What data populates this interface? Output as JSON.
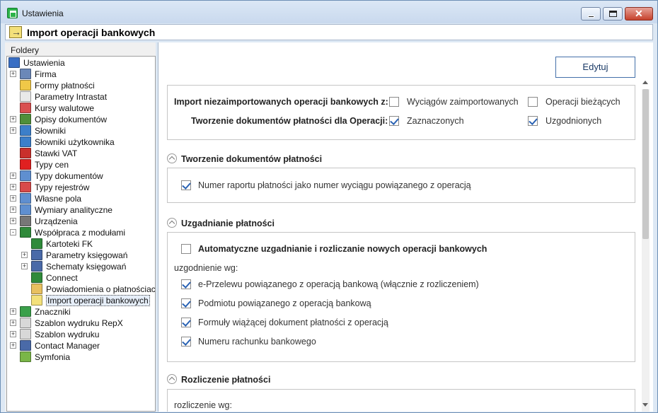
{
  "window": {
    "title": "Ustawienia",
    "accent_color": "#2cb34a",
    "controls": {
      "minimize_icon": "minimize-icon",
      "maximize_icon": "maximize-icon",
      "close_icon": "close-icon",
      "close_glyph": "✕"
    }
  },
  "header": {
    "title": "Import operacji bankowych",
    "icon": "import-arrow-icon"
  },
  "left_pane": {
    "folders_label": "Foldery",
    "tree": [
      {
        "label": "Ustawienia",
        "icon": "tools-icon",
        "level": 0,
        "expander": "",
        "color": "#3a6fc4"
      },
      {
        "label": "Firma",
        "icon": "building-icon",
        "level": 1,
        "expander": "+",
        "color": "#6b88b8"
      },
      {
        "label": "Formy płatności",
        "icon": "folder-icon",
        "level": 1,
        "expander": "",
        "color": "#f0c848"
      },
      {
        "label": "Parametry Intrastat",
        "icon": "document-icon",
        "level": 1,
        "expander": "",
        "color": "#e9e9e9"
      },
      {
        "label": "Kursy walutowe",
        "icon": "chart-icon",
        "level": 1,
        "expander": "",
        "color": "#d95050"
      },
      {
        "label": "Opisy dokumentów",
        "icon": "book-icon",
        "level": 1,
        "expander": "+",
        "color": "#4f8f3a"
      },
      {
        "label": "Słowniki",
        "icon": "dictionary-icon",
        "level": 1,
        "expander": "+",
        "color": "#3c7fc9"
      },
      {
        "label": "Słowniki użytkownika",
        "icon": "user-dictionary-icon",
        "level": 1,
        "expander": "",
        "color": "#3c7fc9"
      },
      {
        "label": "Stawki VAT",
        "icon": "vat-icon",
        "level": 1,
        "expander": "",
        "color": "#c9302c"
      },
      {
        "label": "Typy cen",
        "icon": "price-icon",
        "level": 1,
        "expander": "",
        "color": "#e02020"
      },
      {
        "label": "Typy dokumentów",
        "icon": "documents-icon",
        "level": 1,
        "expander": "+",
        "color": "#5f8fd0"
      },
      {
        "label": "Typy rejestrów",
        "icon": "register-icon",
        "level": 1,
        "expander": "+",
        "color": "#d84a4a"
      },
      {
        "label": "Własne pola",
        "icon": "fields-icon",
        "level": 1,
        "expander": "+",
        "color": "#5f8fd0"
      },
      {
        "label": "Wymiary analityczne",
        "icon": "dimensions-icon",
        "level": 1,
        "expander": "+",
        "color": "#5f8fd0"
      },
      {
        "label": "Urządzenia",
        "icon": "printer-icon",
        "level": 1,
        "expander": "+",
        "color": "#777777"
      },
      {
        "label": "Współpraca z modułami",
        "icon": "module-icon",
        "level": 1,
        "expander": "-",
        "color": "#2f8a3a"
      },
      {
        "label": "Kartoteki FK",
        "icon": "fk-cards-icon",
        "level": 2,
        "expander": "",
        "color": "#2f8a3a"
      },
      {
        "label": "Parametry księgowań",
        "icon": "fk-params-icon",
        "level": 2,
        "expander": "+",
        "color": "#4a6aa8"
      },
      {
        "label": "Schematy księgowań",
        "icon": "fk-schemes-icon",
        "level": 2,
        "expander": "+",
        "color": "#4a6aa8"
      },
      {
        "label": "Connect",
        "icon": "connect-icon",
        "level": 2,
        "expander": "",
        "color": "#2f8a3a"
      },
      {
        "label": "Powiadomienia o płatnościach",
        "icon": "notification-icon",
        "level": 2,
        "expander": "",
        "color": "#e8c060"
      },
      {
        "label": "Import operacji bankowych",
        "icon": "import-icon",
        "level": 2,
        "expander": "",
        "color": "#f3e07a",
        "selected": true
      },
      {
        "label": "Znaczniki",
        "icon": "tags-icon",
        "level": 1,
        "expander": "+",
        "color": "#3aa04a"
      },
      {
        "label": "Szablon wydruku RepX",
        "icon": "template-folder-icon",
        "level": 1,
        "expander": "+",
        "color": "#d8d8d8"
      },
      {
        "label": "Szablon wydruku",
        "icon": "template-folder-icon",
        "level": 1,
        "expander": "+",
        "color": "#d8d8d8"
      },
      {
        "label": "Contact Manager",
        "icon": "contacts-icon",
        "level": 1,
        "expander": "+",
        "color": "#4a6aa8"
      },
      {
        "label": "Symfonia",
        "icon": "symfonia-icon",
        "level": 1,
        "expander": "",
        "color": "#7ab648"
      }
    ]
  },
  "right_pane": {
    "edit_button": "Edytuj",
    "import_section": {
      "row1_label": "Import niezaimportowanych operacji bankowych z:",
      "row1_opt1": "Wyciągów zaimportowanych",
      "row1_opt1_checked": false,
      "row1_opt2": "Operacji bieżących",
      "row1_opt2_checked": false,
      "row2_label": "Tworzenie dokumentów płatności dla Operacji:",
      "row2_opt1": "Zaznaczonych",
      "row2_opt1_checked": true,
      "row2_opt2": "Uzgodnionych",
      "row2_opt2_checked": true
    },
    "section_create": {
      "title": "Tworzenie dokumentów płatności",
      "option": "Numer raportu płatności jako numer wyciągu powiązanego z operacją",
      "checked": true
    },
    "section_match": {
      "title": "Uzgadnianie płatności",
      "auto_label": "Automatyczne uzgadnianie i rozliczanie nowych operacji bankowych",
      "auto_checked": false,
      "by_label": "uzgodnienie wg:",
      "options": [
        {
          "label": "e-Przelewu powiązanego z operacją bankową (włącznie z rozliczeniem)",
          "checked": true
        },
        {
          "label": "Podmiotu powiązanego z operacją bankową",
          "checked": true
        },
        {
          "label": "Formuły wiążącej dokument płatności z operacją",
          "checked": true
        },
        {
          "label": "Numeru rachunku bankowego",
          "checked": true
        }
      ]
    },
    "section_settle": {
      "title": "Rozliczenie płatności",
      "by_label": "rozliczenie wg:"
    }
  }
}
